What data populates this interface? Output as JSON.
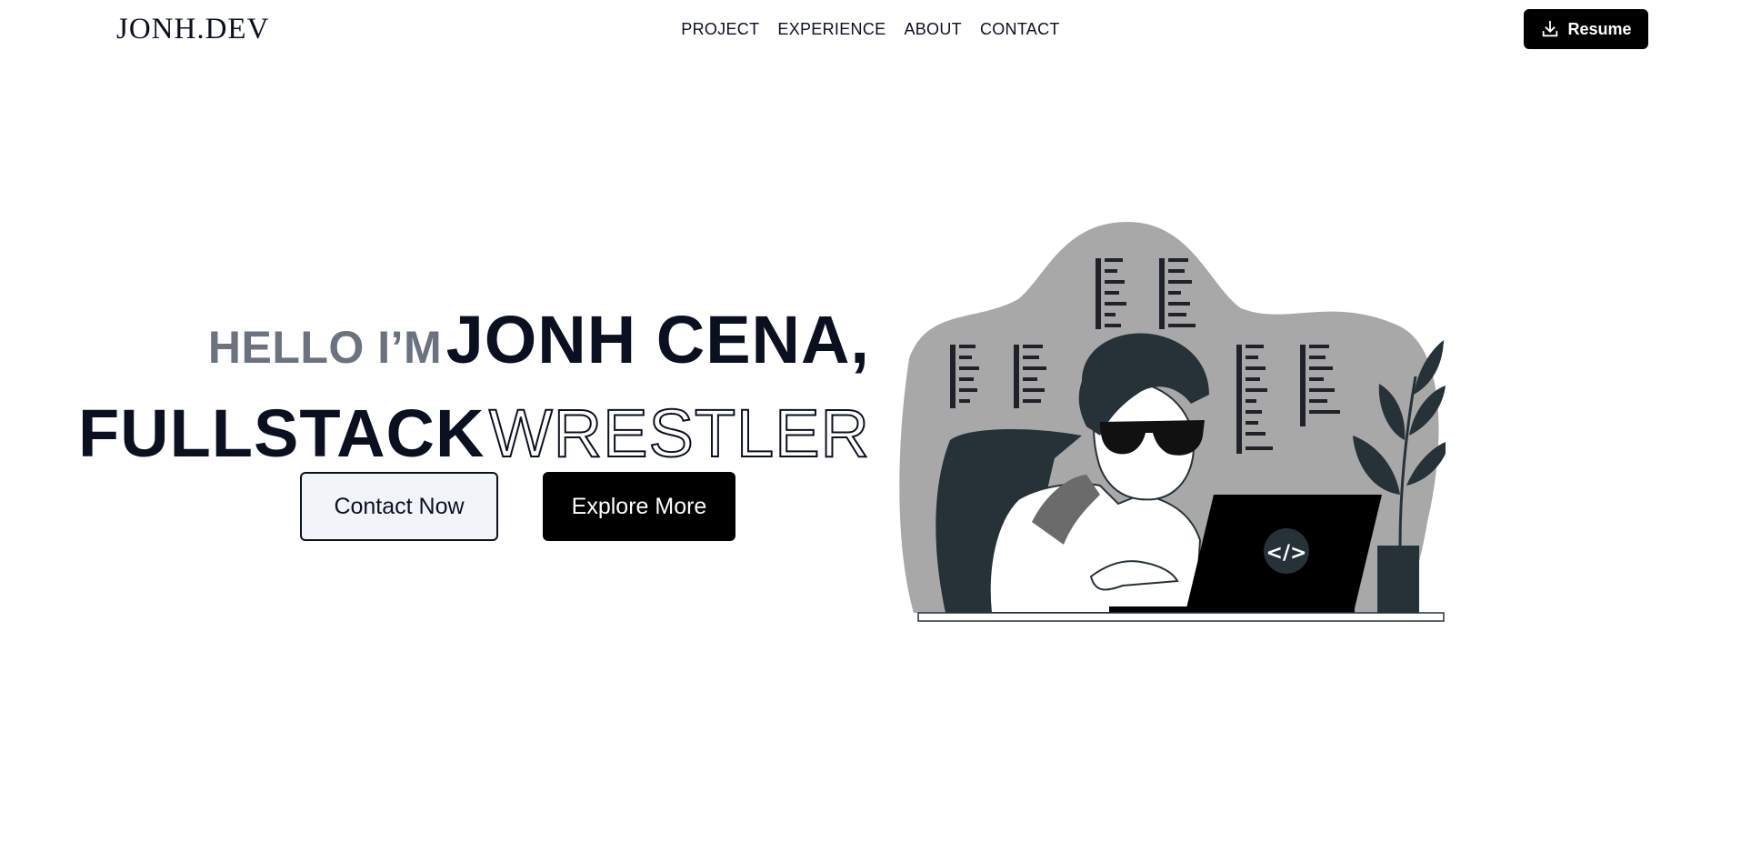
{
  "header": {
    "logo": "JONH.DEV",
    "nav": [
      "PROJECT",
      "EXPERIENCE",
      "ABOUT",
      "CONTACT"
    ],
    "resume_label": "Resume"
  },
  "hero": {
    "greeting": "HELLO I’M",
    "name": "JONH CENA,",
    "role": "FULLSTACK",
    "role_outline": "WRESTLER",
    "contact_label": "Contact Now",
    "explore_label": "Explore More",
    "laptop_code": "</>"
  },
  "icons": {
    "resume": "download-icon",
    "illustration": "developer-illustration",
    "laptop": "code-icon",
    "plant": "plant-icon"
  },
  "colors": {
    "primary": "#000000",
    "text": "#0b1020",
    "muted": "#6b7280",
    "button_light": "#f1f5f9",
    "illustration_bg": "#a8a8a8",
    "illustration_dark": "#263238"
  }
}
